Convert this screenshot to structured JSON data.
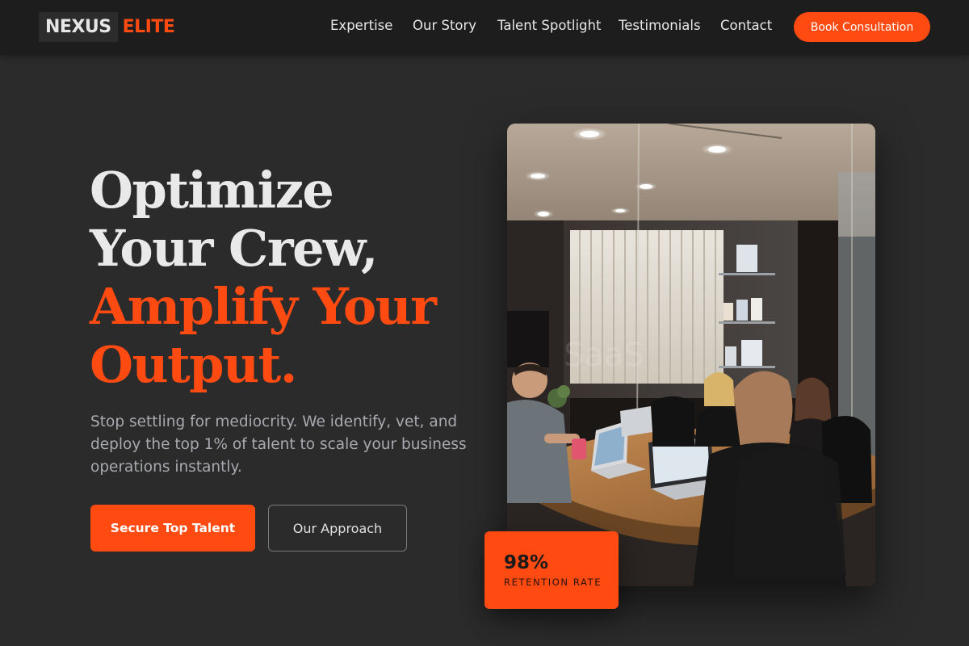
{
  "brand": {
    "name": "NEXUS",
    "accent": "ELITE"
  },
  "nav": {
    "links": [
      "Expertise",
      "Our Story",
      "Talent Spotlight",
      "Testimonials",
      "Contact"
    ],
    "cta_label": "Book Consultation"
  },
  "hero": {
    "title_line1": "Optimize",
    "title_line2": "Your Crew,",
    "title_accent_line1": "Amplify Your",
    "title_accent_line2": "Output.",
    "description": "Stop settling for mediocrity. We identify, vet, and deploy the top 1% of talent to scale your business operations instantly.",
    "primary_label": "Secure Top Talent",
    "secondary_label": "Our Approach"
  },
  "stat": {
    "value": "98%",
    "label": "RETENTION RATE"
  },
  "colors": {
    "accent": "#ff4a12",
    "background": "#2b2b2b",
    "navbar": "#1d1d1d"
  }
}
